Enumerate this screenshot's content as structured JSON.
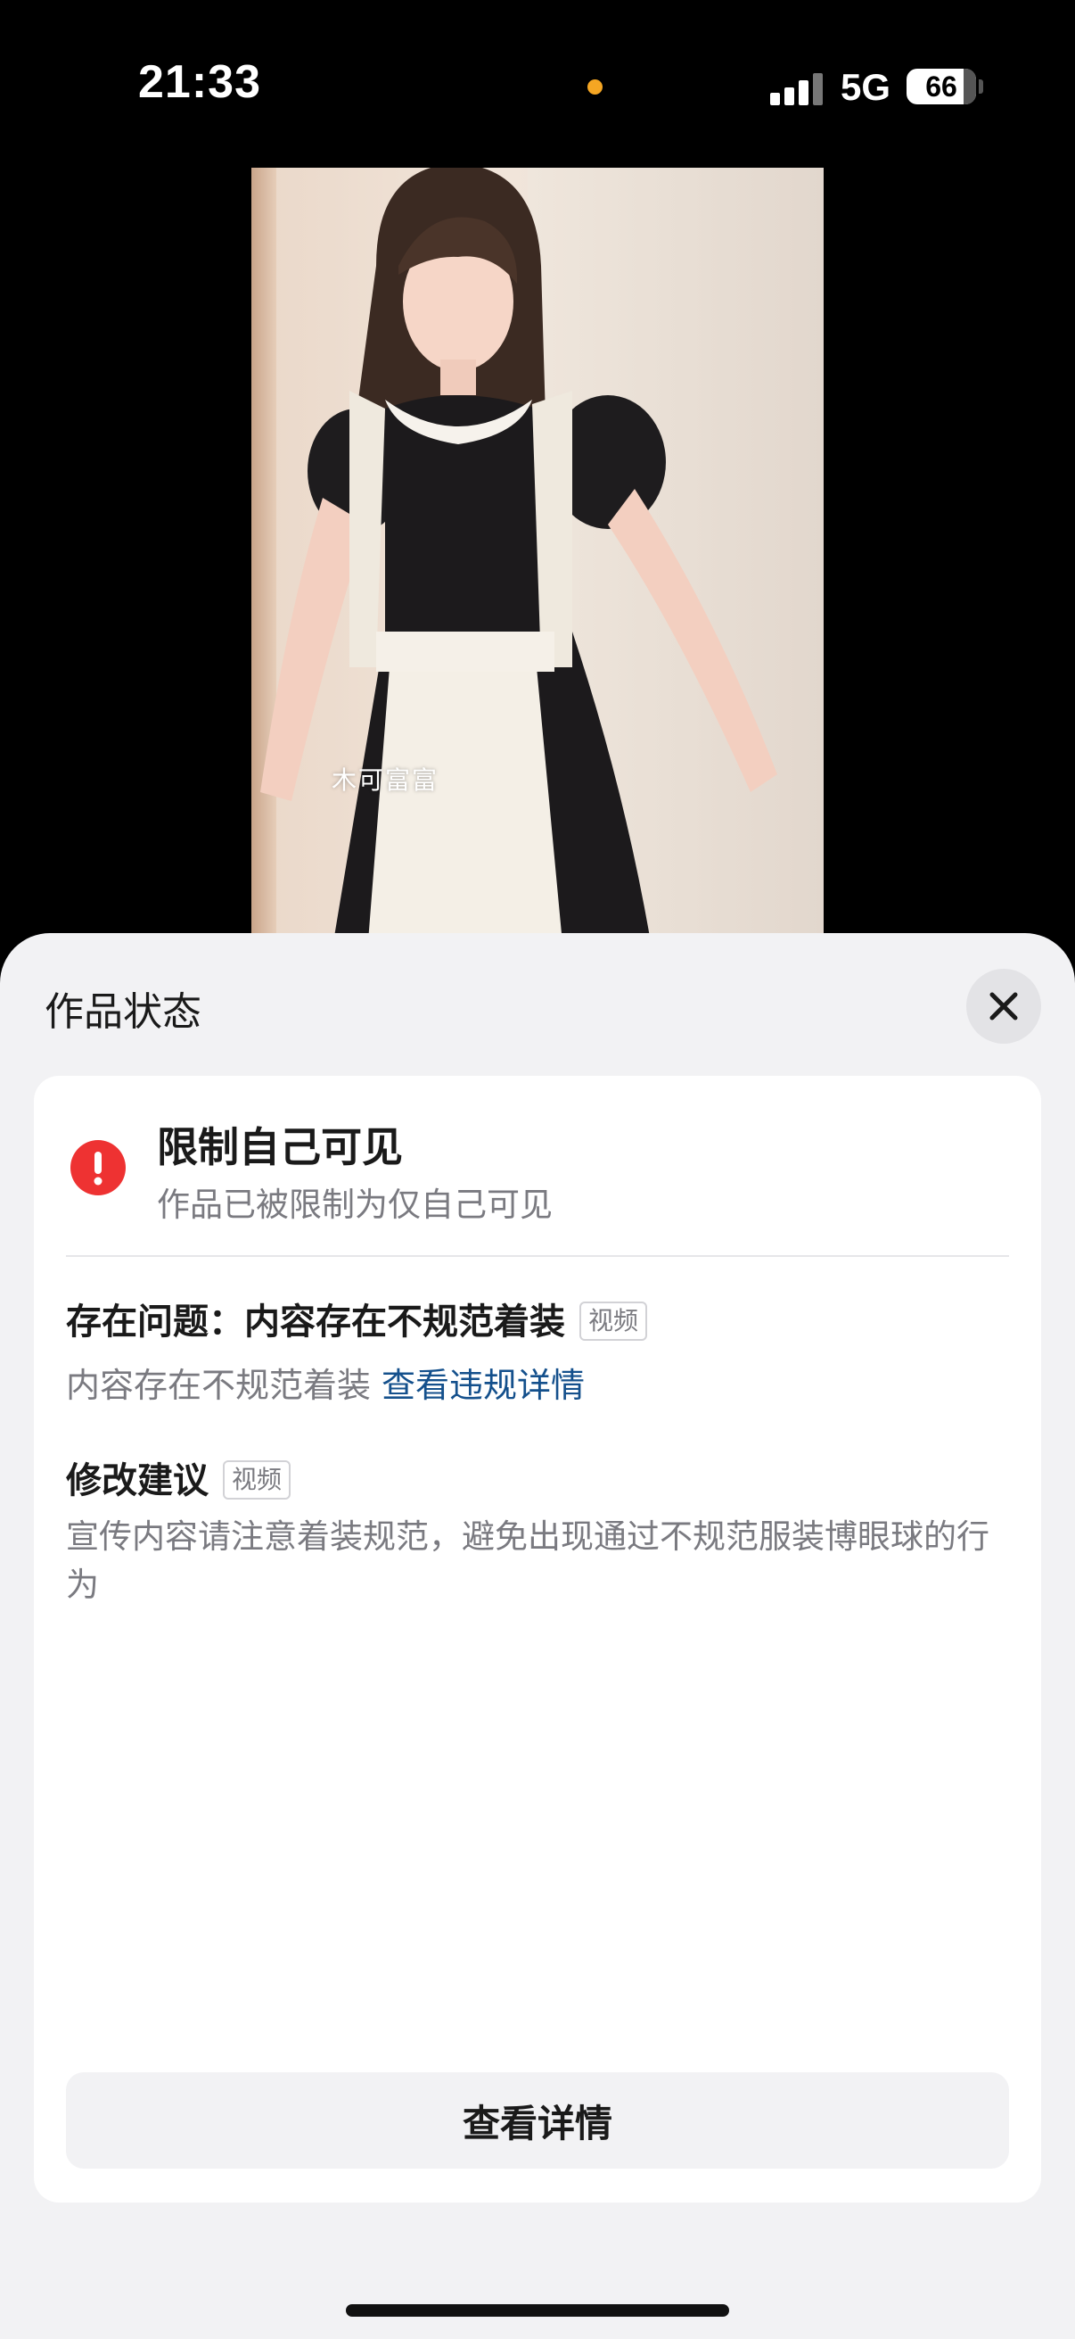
{
  "status_bar": {
    "time": "21:33",
    "network": "5G",
    "battery": "66"
  },
  "video": {
    "watermark": "木可富富",
    "description": "preview of the restricted video (person in maid outfit)"
  },
  "sheet": {
    "title": "作品状态",
    "close_icon": "close-icon",
    "restriction": {
      "title": "限制自己可见",
      "subtitle": "作品已被限制为仅自己可见",
      "icon": "exclamation-alert-icon",
      "icon_color": "#ee3232"
    },
    "issue": {
      "title": "存在问题：内容存在不规范着装",
      "tag": "视频",
      "description": "内容存在不规范着装",
      "link": "查看违规详情",
      "link_color": "#14508c"
    },
    "suggestion": {
      "title": "修改建议",
      "tag": "视频",
      "description": "宣传内容请注意着装规范，避免出现通过不规范服装博眼球的行为"
    },
    "detail_button": "查看详情"
  }
}
